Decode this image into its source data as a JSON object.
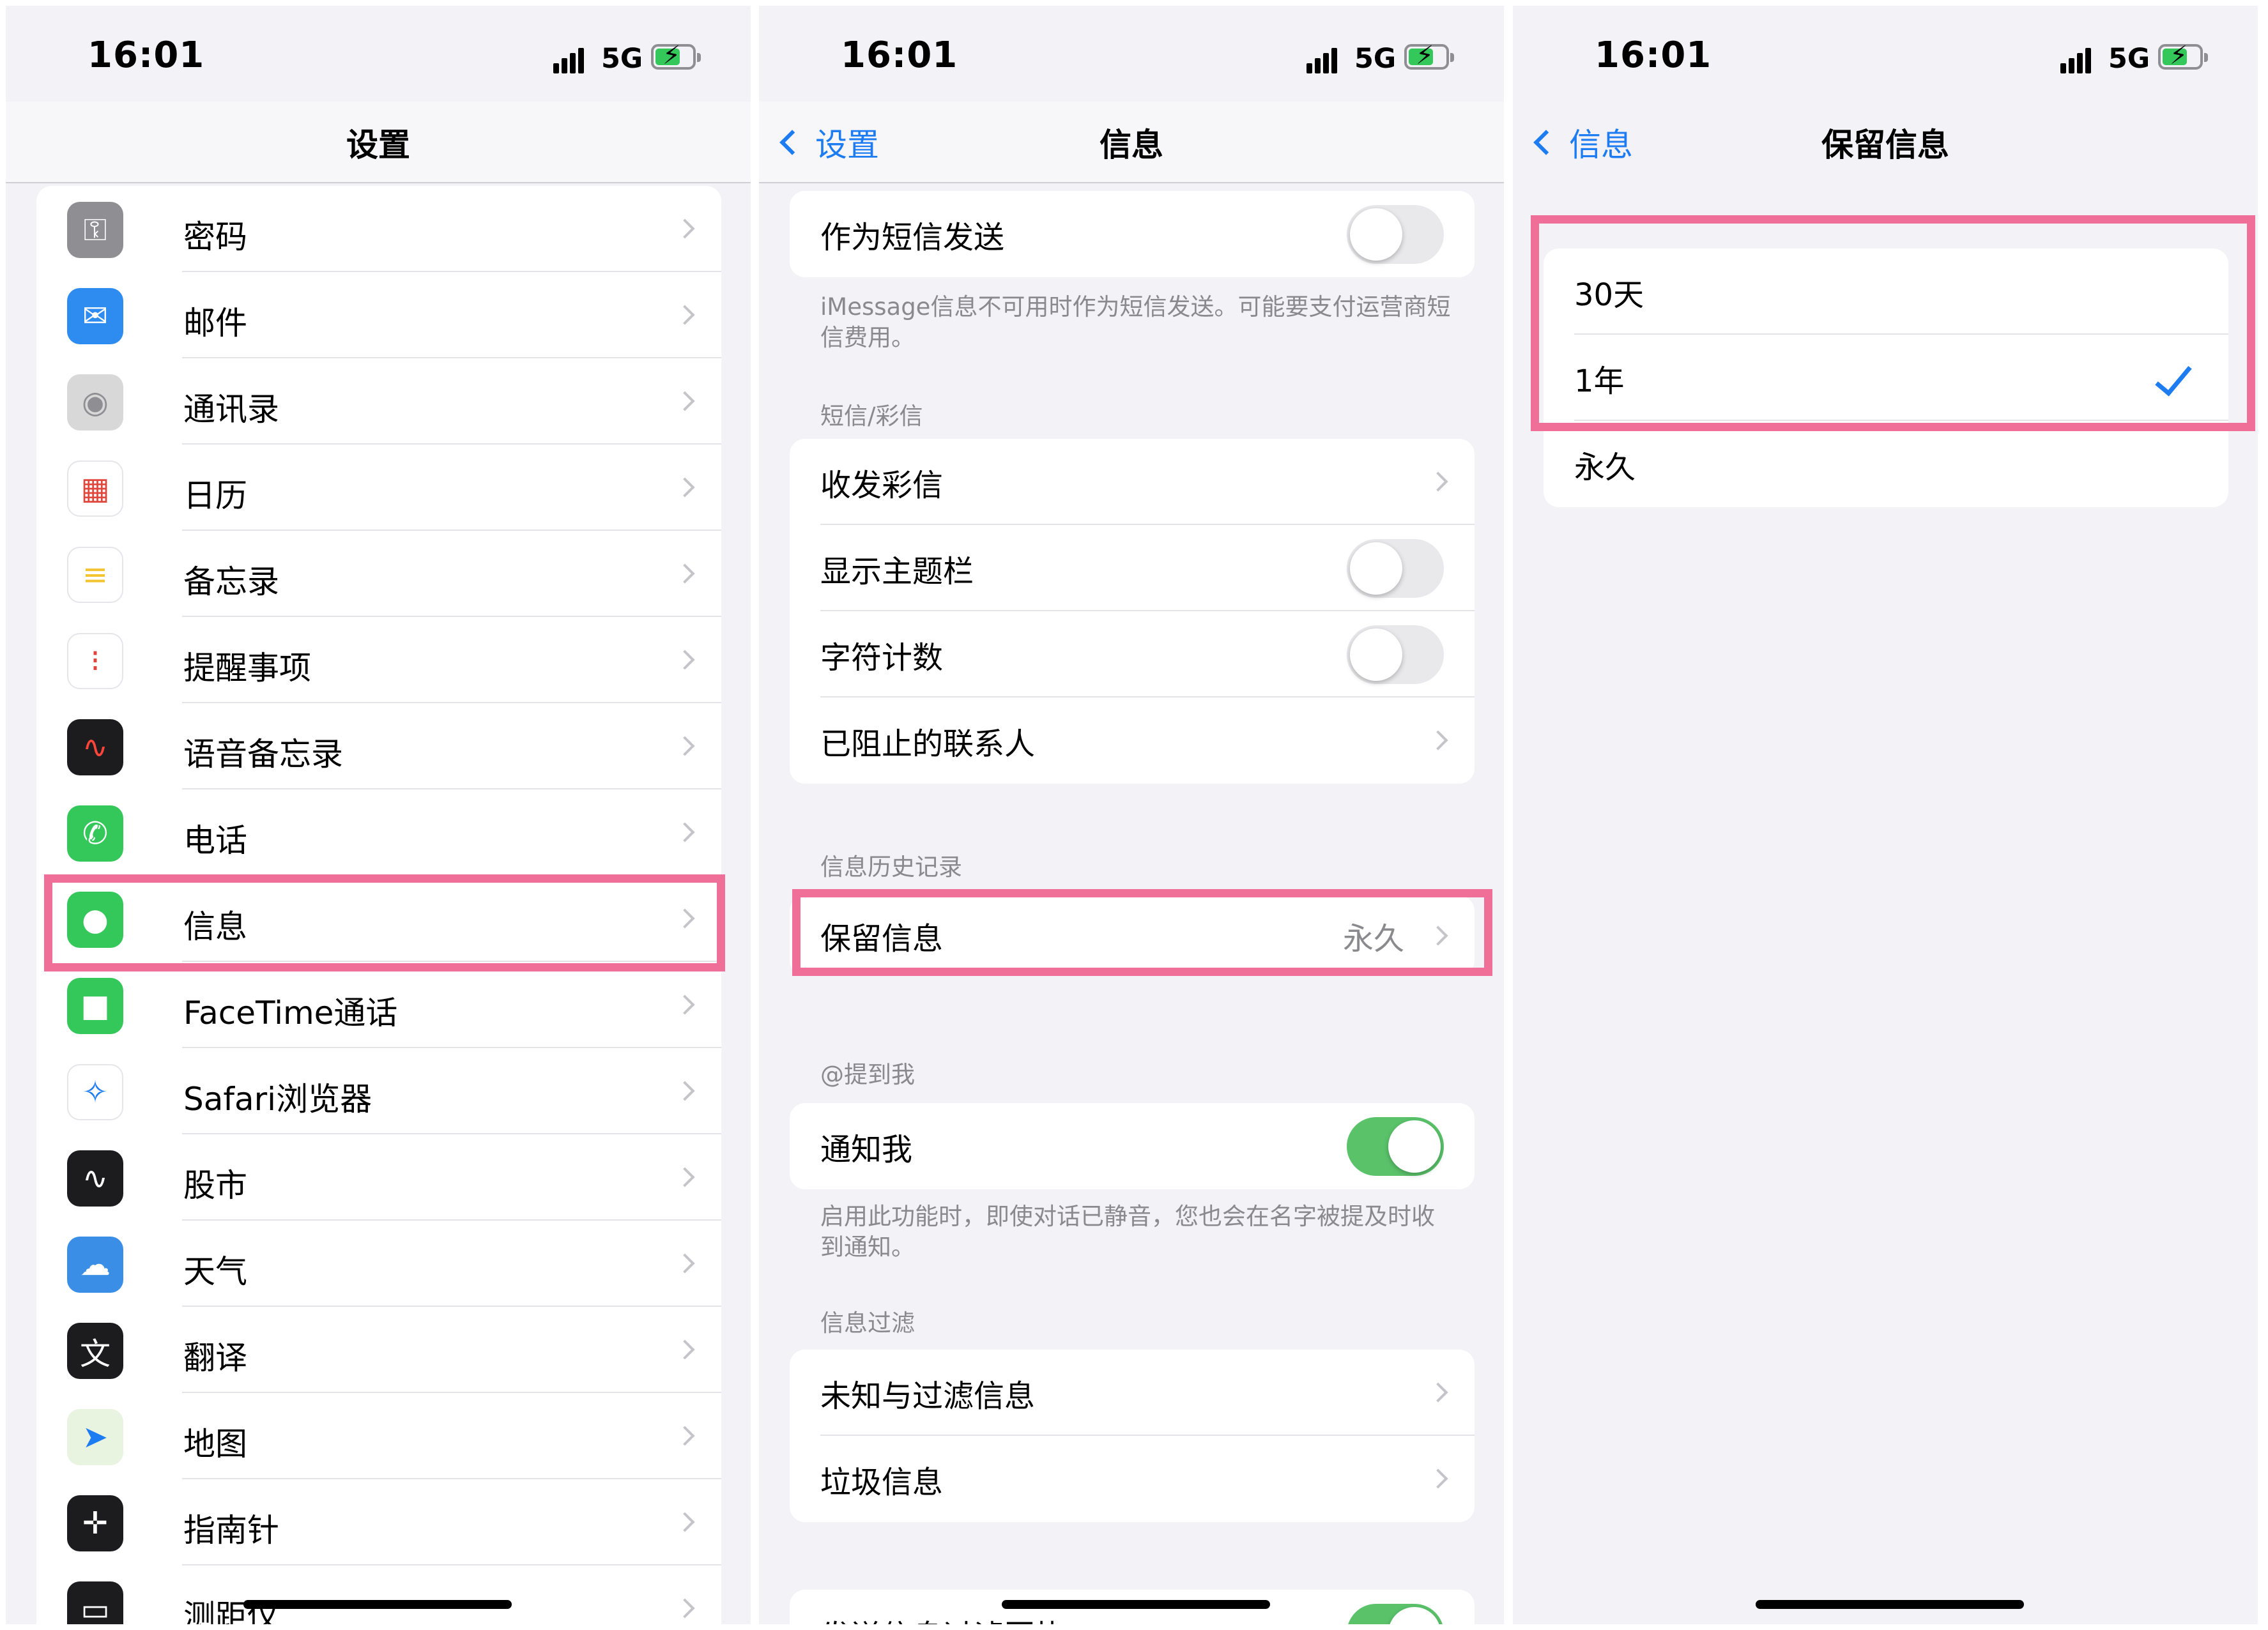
{
  "status": {
    "time": "16:01",
    "network": "5G"
  },
  "panel1": {
    "title": "设置",
    "items": [
      {
        "label": "密码",
        "icon": "key-icon",
        "color": "#8e8e93"
      },
      {
        "label": "邮件",
        "icon": "mail-icon",
        "color": "#2e8cf0"
      },
      {
        "label": "通讯录",
        "icon": "contacts-icon",
        "color": "#d8d8d8"
      },
      {
        "label": "日历",
        "icon": "calendar-icon",
        "color": "#ffffff"
      },
      {
        "label": "备忘录",
        "icon": "notes-icon",
        "color": "#ffffff"
      },
      {
        "label": "提醒事项",
        "icon": "reminders-icon",
        "color": "#ffffff"
      },
      {
        "label": "语音备忘录",
        "icon": "voice-memos-icon",
        "color": "#1c1c1e"
      },
      {
        "label": "电话",
        "icon": "phone-icon",
        "color": "#34c759"
      },
      {
        "label": "信息",
        "icon": "messages-icon",
        "color": "#34c759"
      },
      {
        "label": "FaceTime通话",
        "icon": "facetime-icon",
        "color": "#34c759"
      },
      {
        "label": "Safari浏览器",
        "icon": "safari-icon",
        "color": "#ffffff"
      },
      {
        "label": "股市",
        "icon": "stocks-icon",
        "color": "#1c1c1e"
      },
      {
        "label": "天气",
        "icon": "weather-icon",
        "color": "#3a8ee6"
      },
      {
        "label": "翻译",
        "icon": "translate-icon",
        "color": "#1c1c1e"
      },
      {
        "label": "地图",
        "icon": "maps-icon",
        "color": "#e8f3e0"
      },
      {
        "label": "指南针",
        "icon": "compass-icon",
        "color": "#1c1c1e"
      },
      {
        "label": "测距仪",
        "icon": "measure-icon",
        "color": "#1c1c1e"
      }
    ]
  },
  "panel2": {
    "back": "设置",
    "title": "信息",
    "send_as_sms": "作为短信发送",
    "sms_note": "iMessage信息不可用时作为短信发送。可能要支付运营商短信费用。",
    "sms_header": "短信/彩信",
    "mms": "收发彩信",
    "show_subject": "显示主题栏",
    "char_count": "字符计数",
    "blocked": "已阻止的联系人",
    "history_header": "信息历史记录",
    "keep_messages": "保留信息",
    "keep_value": "永久",
    "mention_header": "@提到我",
    "notify_me": "通知我",
    "notify_note": "启用此功能时，即使对话已静音，您也会在名字被提及时收到通知。",
    "filter_header": "信息过滤",
    "unknown_filter": "未知与过滤信息",
    "junk": "垃圾信息",
    "send_filter": "发送信息过滤回执"
  },
  "panel3": {
    "back": "信息",
    "title": "保留信息",
    "options": [
      "30天",
      "1年",
      "永久"
    ],
    "selected": "1年"
  },
  "colors": {
    "accent": "#1e7cf2",
    "highlight": "#ef6f98",
    "toggle_on": "#5ac36a"
  }
}
